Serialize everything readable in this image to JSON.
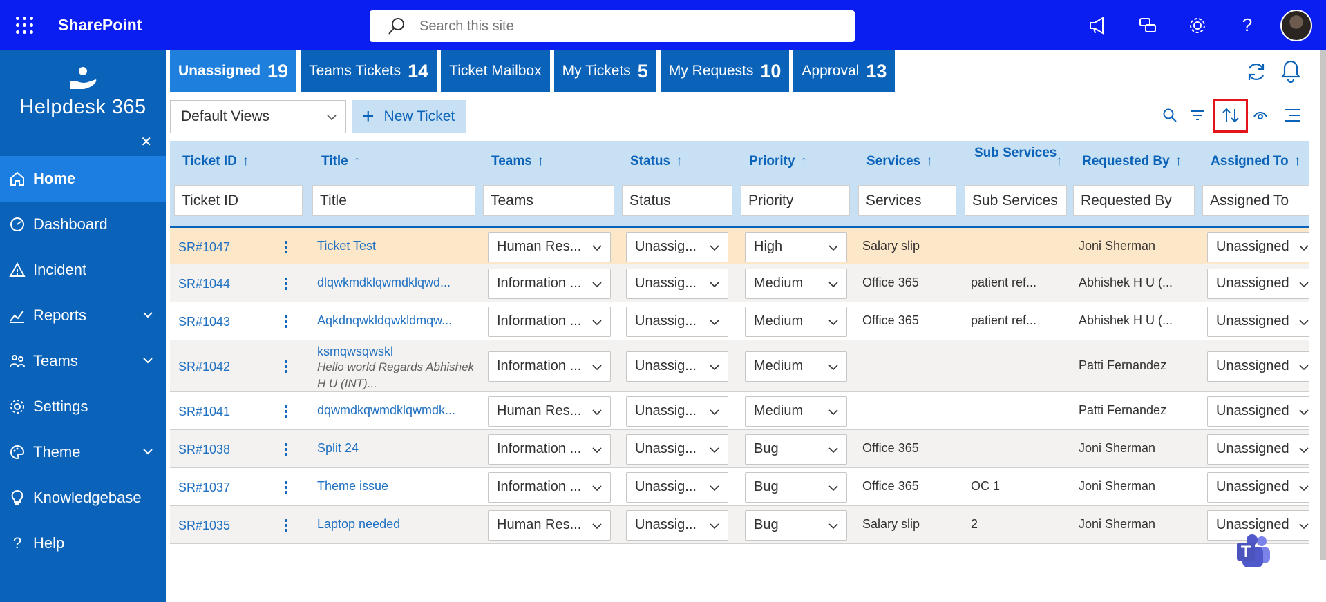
{
  "suite": {
    "brand": "SharePoint",
    "search_placeholder": "Search this site",
    "icons": [
      "megaphone-icon",
      "feedback-icon",
      "gear-icon",
      "help-icon"
    ]
  },
  "sidebar": {
    "app_title": "Helpdesk 365",
    "items": [
      {
        "label": "Home",
        "icon": "home-icon",
        "active": true
      },
      {
        "label": "Dashboard",
        "icon": "dashboard-icon"
      },
      {
        "label": "Incident",
        "icon": "warning-icon"
      },
      {
        "label": "Reports",
        "icon": "chart-icon",
        "expandable": true
      },
      {
        "label": "Teams",
        "icon": "people-icon",
        "expandable": true
      },
      {
        "label": "Settings",
        "icon": "gear-icon"
      },
      {
        "label": "Theme",
        "icon": "palette-icon",
        "expandable": true
      },
      {
        "label": "Knowledgebase",
        "icon": "lightbulb-icon"
      },
      {
        "label": "Help",
        "icon": "question-icon"
      }
    ]
  },
  "tabs": [
    {
      "label": "Unassigned",
      "count": "19"
    },
    {
      "label": "Teams Tickets",
      "count": "14"
    },
    {
      "label": "Ticket Mailbox",
      "count": ""
    },
    {
      "label": "My Tickets",
      "count": "5"
    },
    {
      "label": "My Requests",
      "count": "10"
    },
    {
      "label": "Approval",
      "count": "13"
    }
  ],
  "toolbar": {
    "views_value": "Default Views",
    "new_ticket_label": "New Ticket"
  },
  "columns": [
    {
      "label": "Ticket ID",
      "filter": "Ticket ID"
    },
    {
      "label": "Title",
      "filter": "Title"
    },
    {
      "label": "Teams",
      "filter": "Teams"
    },
    {
      "label": "Status",
      "filter": "Status"
    },
    {
      "label": "Priority",
      "filter": "Priority"
    },
    {
      "label": "Services",
      "filter": "Services"
    },
    {
      "label": "Sub Services",
      "filter": "Sub Services"
    },
    {
      "label": "Requested By",
      "filter": "Requested By"
    },
    {
      "label": "Assigned To",
      "filter": "Assigned To"
    }
  ],
  "sort_arrow": "↑",
  "rows": [
    {
      "id": "SR#1047",
      "title": "Ticket Test",
      "title_sub": "",
      "team": "Human Res...",
      "status": "Unassig...",
      "priority": "High",
      "service": "Salary slip",
      "sub_service": "",
      "requested_by": "Joni Sherman",
      "assigned": "Unassigned"
    },
    {
      "id": "SR#1044",
      "title": "dlqwkmdklqwmdklqwd...",
      "title_sub": "",
      "team": "Information ...",
      "status": "Unassig...",
      "priority": "Medium",
      "service": "Office 365",
      "sub_service": "patient ref...",
      "requested_by": "Abhishek H U (...",
      "assigned": "Unassigned"
    },
    {
      "id": "SR#1043",
      "title": "Aqkdnqwkldqwkldmqw...",
      "title_sub": "",
      "team": "Information ...",
      "status": "Unassig...",
      "priority": "Medium",
      "service": "Office 365",
      "sub_service": "patient ref...",
      "requested_by": "Abhishek H U (...",
      "assigned": "Unassigned"
    },
    {
      "id": "SR#1042",
      "title": "ksmqwsqwskl",
      "title_sub": "Hello world Regards Abhishek H U (INT)...",
      "team": "Information ...",
      "status": "Unassig...",
      "priority": "Medium",
      "service": "",
      "sub_service": "",
      "requested_by": "Patti Fernandez",
      "assigned": "Unassigned"
    },
    {
      "id": "SR#1041",
      "title": "dqwmdkqwmdklqwmdk...",
      "title_sub": "",
      "team": "Human Res...",
      "status": "Unassig...",
      "priority": "Medium",
      "service": "",
      "sub_service": "",
      "requested_by": "Patti Fernandez",
      "assigned": "Unassigned"
    },
    {
      "id": "SR#1038",
      "title": "Split 24",
      "title_sub": "",
      "team": "Information ...",
      "status": "Unassig...",
      "priority": "Bug",
      "service": "Office 365",
      "sub_service": "",
      "requested_by": "Joni Sherman",
      "assigned": "Unassigned"
    },
    {
      "id": "SR#1037",
      "title": "Theme issue",
      "title_sub": "",
      "team": "Information ...",
      "status": "Unassig...",
      "priority": "Bug",
      "service": "Office 365",
      "sub_service": "OC 1",
      "requested_by": "Joni Sherman",
      "assigned": "Unassigned"
    },
    {
      "id": "SR#1035",
      "title": "Laptop needed",
      "title_sub": "",
      "team": "Human Res...",
      "status": "Unassig...",
      "priority": "Bug",
      "service": "Salary slip",
      "sub_service": "2",
      "requested_by": "Joni Sherman",
      "assigned": "Unassigned"
    }
  ],
  "colors": {
    "suite": "#0b1ef2",
    "sidebar": "#0b63b9",
    "accent": "#1f7fdc",
    "highlight_row": "#fde7c9",
    "sort_highlight": "#e4141b"
  }
}
